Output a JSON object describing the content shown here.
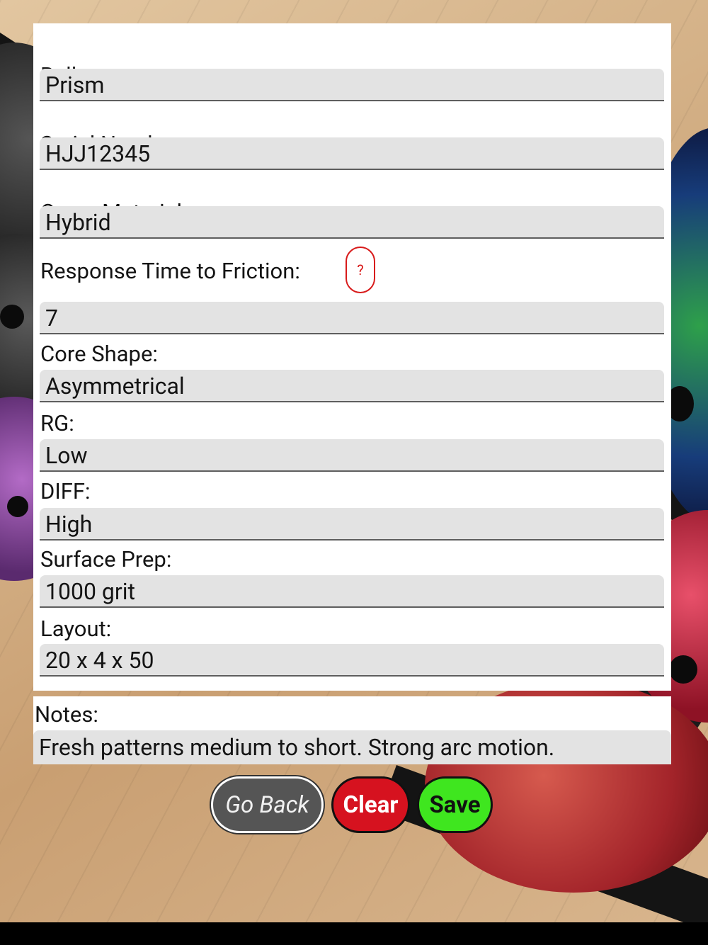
{
  "form": {
    "fields": [
      {
        "label": "Ball:",
        "value": "Prism"
      },
      {
        "label": "Serial Number:",
        "value": "HJJ12345"
      },
      {
        "label": "Cover Material:",
        "value": "Hybrid"
      },
      {
        "label": "Response Time to Friction:",
        "value": "7"
      },
      {
        "label": "Core Shape:",
        "value": "Asymmetrical"
      },
      {
        "label": "RG:",
        "value": "Low"
      },
      {
        "label": "DIFF:",
        "value": "High"
      },
      {
        "label": "Surface Prep:",
        "value": "1000 grit"
      },
      {
        "label": "Layout:",
        "value": "20 x 4 x 50"
      }
    ],
    "help_label": "?",
    "notes_label": "Notes:",
    "notes_value": "Fresh patterns medium to short. Strong arc motion."
  },
  "buttons": {
    "go_back": "Go Back",
    "clear": "Clear",
    "save": "Save"
  },
  "colors": {
    "clear_button": "#d6121f",
    "save_button": "#3fe61f",
    "back_button": "#555555",
    "help_accent": "#d81b1b",
    "input_background": "#e3e3e3"
  }
}
